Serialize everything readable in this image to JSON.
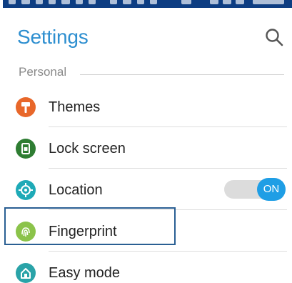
{
  "header": {
    "title": "Settings"
  },
  "section": {
    "label": "Personal"
  },
  "items": [
    {
      "label": "Themes",
      "icon": "themes-brush-icon",
      "color": "#e8672a"
    },
    {
      "label": "Lock screen",
      "icon": "lock-screen-icon",
      "color": "#2e7d32"
    },
    {
      "label": "Location",
      "icon": "location-target-icon",
      "color": "#1eaab7"
    },
    {
      "label": "Fingerprint",
      "icon": "fingerprint-icon",
      "color": "#8bc34a"
    },
    {
      "label": "Easy mode",
      "icon": "easy-mode-icon",
      "color": "#2aa3a8"
    }
  ],
  "location_toggle": {
    "state": "ON"
  },
  "colors": {
    "accent": "#2e8fd0",
    "statusbar": "#0d3d82",
    "toggle_on": "#1f9ee5"
  }
}
